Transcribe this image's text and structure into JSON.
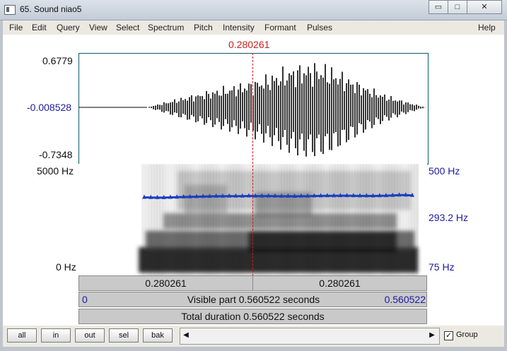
{
  "window": {
    "title": "65. Sound niao5",
    "min_glyph": "▭",
    "max_glyph": "□",
    "close_glyph": "✕"
  },
  "menu": [
    "File",
    "Edit",
    "Query",
    "View",
    "Select",
    "Spectrum",
    "Pitch",
    "Intensity",
    "Formant",
    "Pulses"
  ],
  "help": "Help",
  "cursor_time": "0.280261",
  "waveform": {
    "max": "0.6779",
    "mid": "-0.008528",
    "min": "-0.7348"
  },
  "spectrogram": {
    "top_freq": "5000 Hz",
    "bottom_freq": "0 Hz",
    "pitch_top": "500 Hz",
    "pitch_value": "293.2 Hz",
    "pitch_bottom": "75 Hz"
  },
  "segments": {
    "left": "0.280261",
    "right": "0.280261"
  },
  "visible": {
    "start": "0",
    "label": "Visible part 0.560522 seconds",
    "end": "0.560522"
  },
  "total": {
    "label": "Total duration 0.560522 seconds"
  },
  "buttons": {
    "all": "all",
    "in": "in",
    "out": "out",
    "sel": "sel",
    "bak": "bak"
  },
  "scroll": {
    "left": "◀",
    "right": "▶"
  },
  "group": {
    "label": "Group",
    "checked": true,
    "mark": "✓"
  },
  "pitch_contour": [
    282.7,
    281.8,
    281.2,
    281.4,
    282.6,
    283.8,
    284.7,
    285.3,
    286.1,
    287.0,
    287.4,
    288.0,
    288.3,
    288.4,
    288.8,
    288.9,
    289.4,
    289.2,
    289.2,
    289.2,
    288.5,
    288.2,
    288.2,
    287.9,
    288.7,
    289.0,
    289.7,
    290.0,
    290.6,
    290.7,
    291.0,
    290.8,
    290.6,
    290.0,
    289.9,
    289.4,
    290.1,
    290.8,
    292.1,
    293.7,
    293.6,
    292.0
  ]
}
